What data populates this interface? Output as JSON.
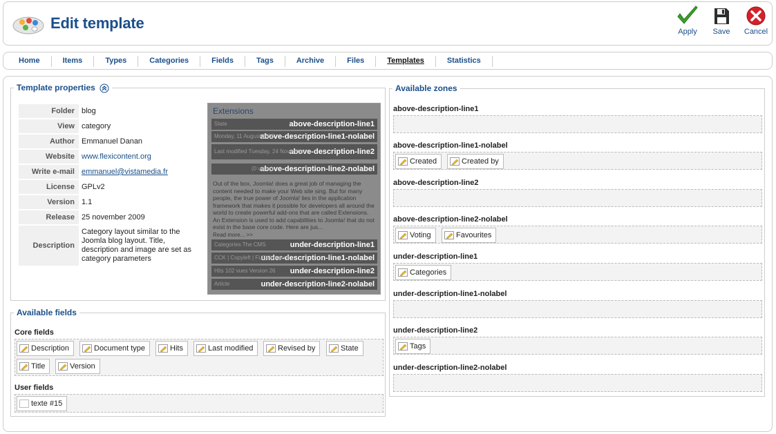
{
  "header": {
    "title": "Edit template",
    "apply_label": "Apply",
    "save_label": "Save",
    "cancel_label": "Cancel"
  },
  "nav": {
    "items": [
      "Home",
      "Items",
      "Types",
      "Categories",
      "Fields",
      "Tags",
      "Archive",
      "Files",
      "Templates",
      "Statistics"
    ],
    "active": "Templates"
  },
  "properties": {
    "legend": "Template properties",
    "rows": [
      {
        "key": "Folder",
        "value": "blog"
      },
      {
        "key": "View",
        "value": "category"
      },
      {
        "key": "Author",
        "value": "Emmanuel Danan"
      },
      {
        "key": "Website",
        "value": "www.flexicontent.org"
      },
      {
        "key": "Write e-mail",
        "value": "emmanuel@vistamedia.fr"
      },
      {
        "key": "License",
        "value": "GPLv2"
      },
      {
        "key": "Version",
        "value": "1.1"
      },
      {
        "key": "Release",
        "value": "25 november 2009"
      },
      {
        "key": "Description",
        "value": "Category layout similar to the Joomla blog layout. Title, description and image are set as category parameters"
      }
    ]
  },
  "preview": {
    "title": "Extensions",
    "bars": [
      {
        "label": "above-description-line1",
        "ghost": "State"
      },
      {
        "label": "above-description-line1-nolabel",
        "ghost": "Monday, 11 August 2008"
      },
      {
        "label": "above-description-line2",
        "ghost": "Last modified Tuesday, 24 November"
      },
      {
        "label": "above-description-line2-nolabel",
        "ghost": "(0 votes)"
      },
      {
        "label": "under-description-line1",
        "ghost": "Categories The CMS"
      },
      {
        "label": "under-description-line1-nolabel",
        "ghost": "CCK | Copyleft | FLEXIcontent"
      },
      {
        "label": "under-description-line2",
        "ghost": "Hits 102 vues  Version 26"
      },
      {
        "label": "under-description-line2-nolabel",
        "ghost": "Article"
      }
    ],
    "text": "Out of the box, Joomla! does a great job of managing the content needed to make your Web site sing. But for many people, the true power of Joomla! lies in the application framework that makes it possible for developers all around the world to create powerful add-ons that are called Extensions. An Extension is used to add capabilities to Joomla! that do not exist in the base core code. Here are jus...",
    "more": "Read more...  >>"
  },
  "fields": {
    "legend": "Available fields",
    "core_title": "Core fields",
    "core": [
      "Description",
      "Document type",
      "Hits",
      "Last modified",
      "Revised by",
      "State",
      "Title",
      "Version"
    ],
    "user_title": "User fields",
    "user": [
      "texte #15"
    ]
  },
  "zones": {
    "legend": "Available zones",
    "list": [
      {
        "name": "above-description-line1",
        "fields": []
      },
      {
        "name": "above-description-line1-nolabel",
        "fields": [
          "Created",
          "Created by"
        ]
      },
      {
        "name": "above-description-line2",
        "fields": []
      },
      {
        "name": "above-description-line2-nolabel",
        "fields": [
          "Voting",
          "Favourites"
        ]
      },
      {
        "name": "under-description-line1",
        "fields": [
          "Categories"
        ]
      },
      {
        "name": "under-description-line1-nolabel",
        "fields": []
      },
      {
        "name": "under-description-line2",
        "fields": [
          "Tags"
        ]
      },
      {
        "name": "under-description-line2-nolabel",
        "fields": []
      }
    ]
  },
  "colors": {
    "link": "#1a4f8b",
    "apply": "#3aa02a",
    "cancel": "#d4212a"
  },
  "icons": {
    "logo": "palette-icon",
    "apply": "checkmark-icon",
    "save": "floppy-disk-icon",
    "cancel": "cancel-circle-icon",
    "chip": "edit-pencil-icon",
    "collapse": "collapse-arrow-icon"
  }
}
